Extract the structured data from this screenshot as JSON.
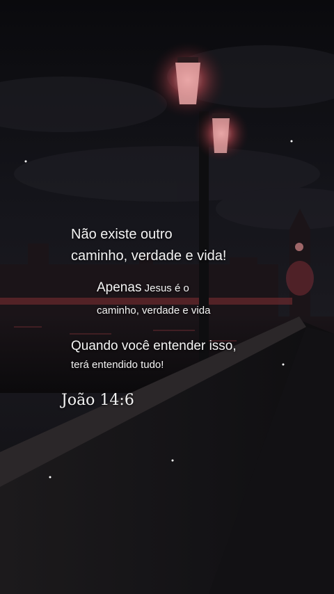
{
  "quote": {
    "line1": "Não existe outro",
    "line2": "caminho, verdade e vida!",
    "line3_big": "Apenas",
    "line3_small": " Jesus é o",
    "line4": "caminho, verdade e vida",
    "line5": "Quando você entender isso,",
    "line6": "terá entendido tudo!"
  },
  "reference": "João 14:6",
  "colors": {
    "sky": "#0d0d12",
    "lamp_glow": "#e4898a",
    "text": "#f4f4f4"
  }
}
